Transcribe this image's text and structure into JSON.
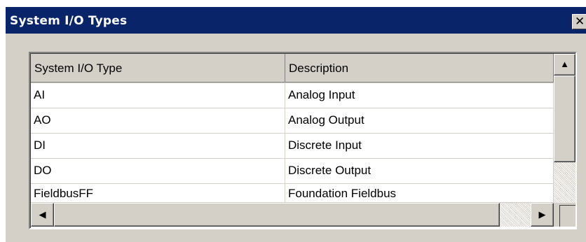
{
  "window": {
    "title": "System I/O Types",
    "close_glyph": "✕"
  },
  "table": {
    "columns": [
      "System I/O Type",
      "Description"
    ],
    "rows": [
      {
        "type": "AI",
        "description": "Analog Input"
      },
      {
        "type": "AO",
        "description": "Analog Output"
      },
      {
        "type": "DI",
        "description": "Discrete Input"
      },
      {
        "type": "DO",
        "description": "Discrete Output"
      },
      {
        "type": "FieldbusFF",
        "description": "Foundation Fieldbus"
      }
    ]
  },
  "scrollbars": {
    "up_glyph": "▲",
    "left_glyph": "◀",
    "right_glyph": "▶"
  },
  "colors": {
    "titlebar": "#0a246a",
    "face": "#d4d0c8"
  }
}
